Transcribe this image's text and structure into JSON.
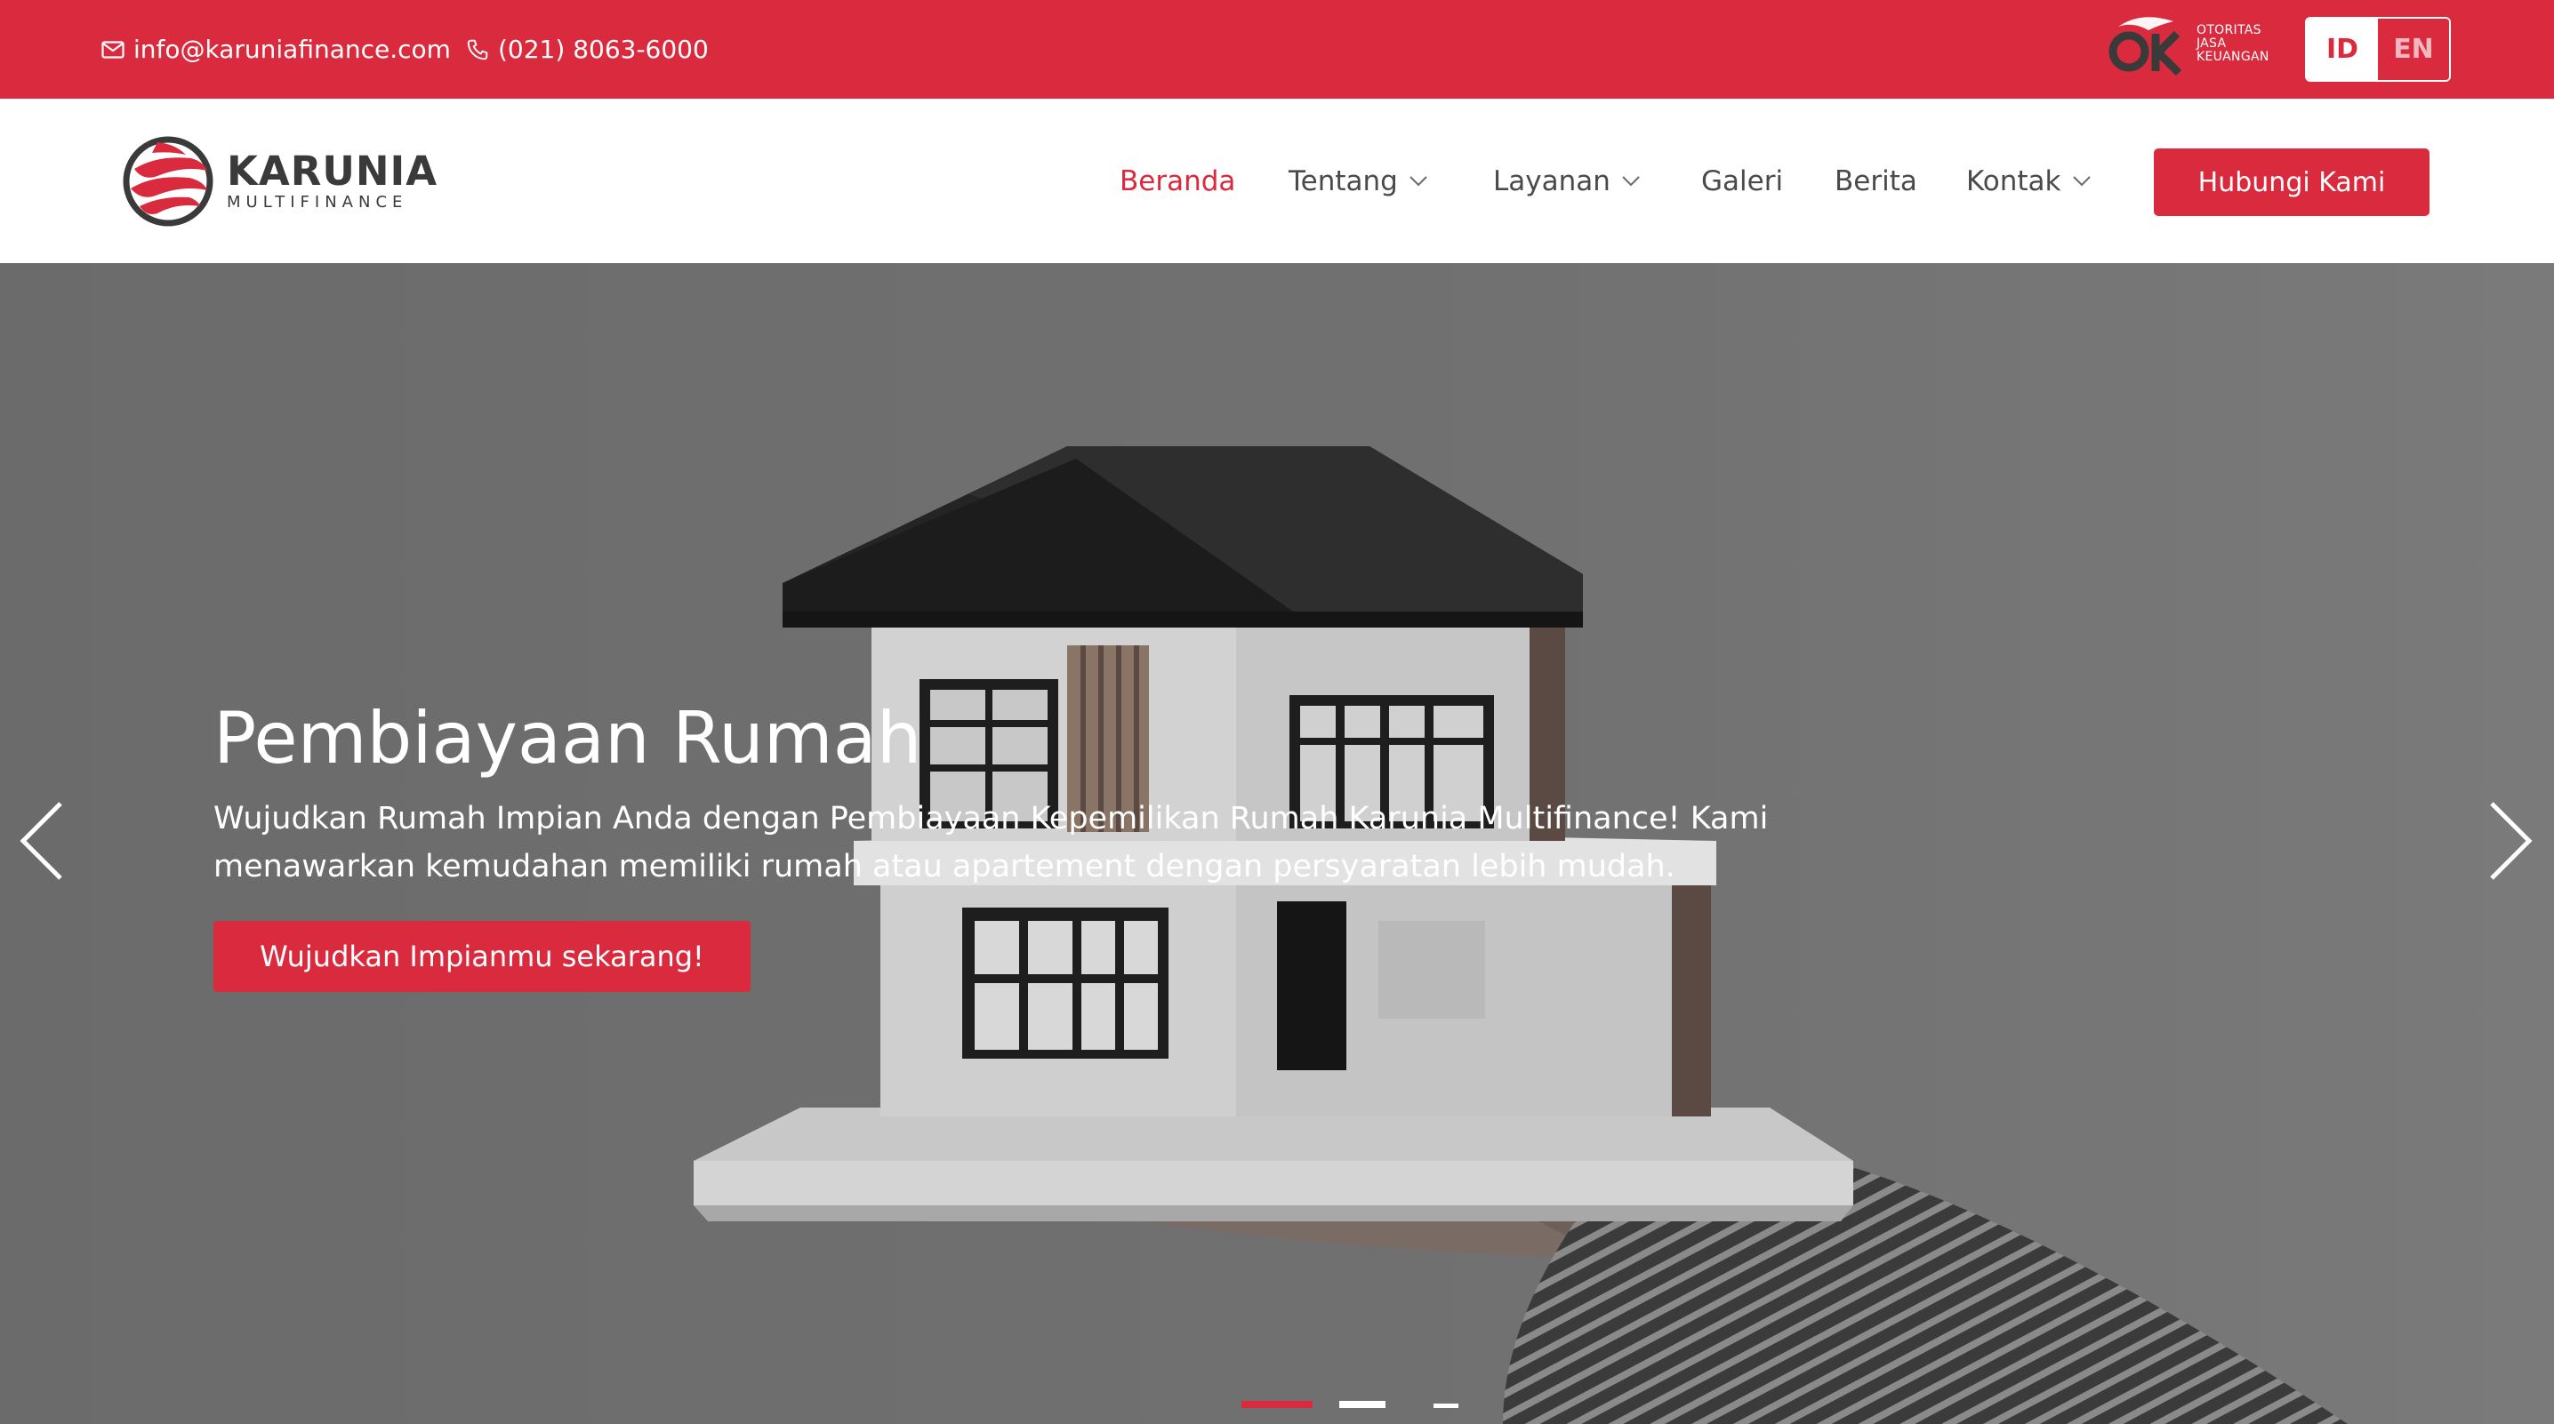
{
  "topbar": {
    "email": "info@karuniafinance.com",
    "phone": "(021) 8063-6000",
    "ojk": {
      "line1": "OTORITAS",
      "line2": "JASA",
      "line3": "KEUANGAN"
    },
    "lang": {
      "id": "ID",
      "en": "EN",
      "active": "ID"
    }
  },
  "brand": {
    "name": "KARUNIA",
    "sub": "MULTIFINANCE"
  },
  "nav": {
    "items": [
      {
        "label": "Beranda"
      },
      {
        "label": "Tentang"
      },
      {
        "label": "Layanan"
      },
      {
        "label": "Galeri"
      },
      {
        "label": "Berita"
      },
      {
        "label": "Kontak"
      }
    ],
    "cta": "Hubungi Kami"
  },
  "hero": {
    "title": "Pembiayaan Rumah",
    "description": "Wujudkan Rumah Impian Anda dengan Pembiayaan Kepemilikan Rumah Karunia Multifinance! Kami menawarkan kemudahan memiliki rumah atau apartement dengan persyaratan lebih mudah.",
    "button": "Wujudkan Impianmu sekarang!",
    "slides_total": 3,
    "slide_active": 1
  },
  "colors": {
    "brand": "#da2a3d",
    "text": "#3a3a3a",
    "white": "#ffffff"
  },
  "icons": [
    "envelope-icon",
    "phone-icon",
    "chevron-down-icon",
    "chevron-left-icon",
    "chevron-right-icon"
  ]
}
